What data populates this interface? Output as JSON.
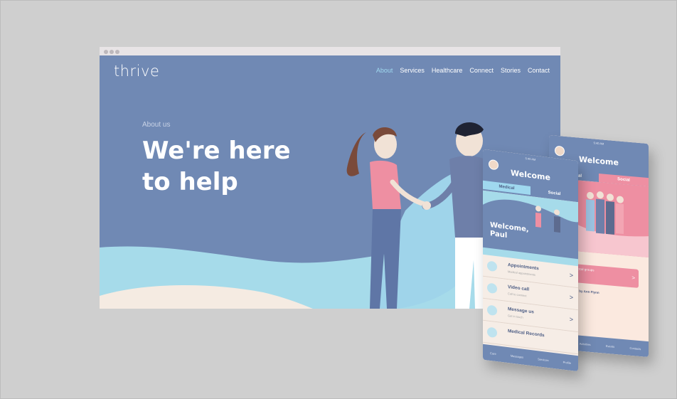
{
  "site": {
    "logo": "thrive",
    "nav": [
      "About",
      "Services",
      "Healthcare",
      "Connect",
      "Stories",
      "Contact"
    ],
    "eyebrow": "About us",
    "hero_line1": "We're here",
    "hero_line2": "to help"
  },
  "phone_front": {
    "status": "5:40 AM",
    "title": "Welcome",
    "tabs": [
      "Medical",
      "Social"
    ],
    "greeting_line1": "Welcome,",
    "greeting_line2": "Paul",
    "items": [
      {
        "title": "Appointments",
        "sub": "Medical appointments"
      },
      {
        "title": "Video call",
        "sub": "Call to connect"
      },
      {
        "title": "Message us",
        "sub": "Get in touch"
      },
      {
        "title": "Medical Records",
        "sub": ""
      }
    ],
    "bottom_nav": [
      "Care",
      "Messages",
      "Services",
      "Profile"
    ]
  },
  "phone_back": {
    "status": "5:40 AM",
    "title": "Welcome",
    "tabs": [
      "Medical",
      "Social"
    ],
    "card_text": "Connect with local groups",
    "post_title": "Posted by Ann Flynn",
    "bottom_nav": [
      "Home",
      "Activities",
      "Events",
      "Contacts"
    ]
  },
  "colors": {
    "brand": "#7089b4",
    "accent": "#9fd8ef",
    "pink": "#ee8fa2",
    "cream": "#f6ede6"
  }
}
